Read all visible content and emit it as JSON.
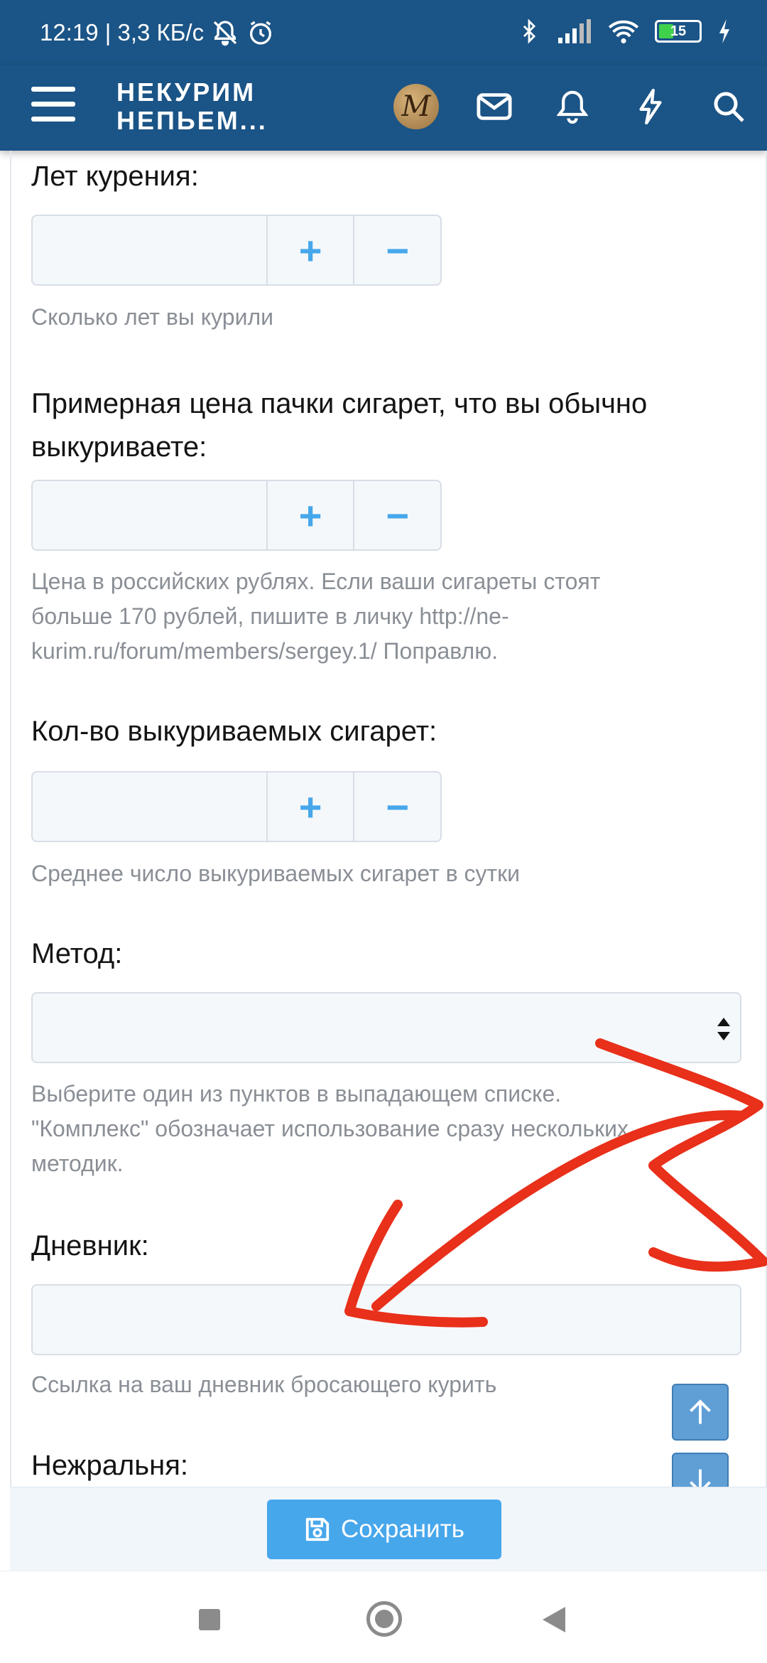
{
  "status_bar": {
    "time_speed": "12:19 | 3,3 КБ/с",
    "battery": "15"
  },
  "header": {
    "brand_line1": "НЕКУРИМ",
    "brand_line2": "НЕПЬЕМ..."
  },
  "form": {
    "years": {
      "label": "Лет курения:",
      "hint": "Сколько лет вы курили"
    },
    "price": {
      "label_line1": "Примерная цена пачки сигарет, что вы обычно",
      "label_line2": "выкуриваете:",
      "hint_line1": "Цена в российских рублях. Если ваши сигареты стоят",
      "hint_line2": "больше 170 рублей, пишите в личку http://ne-",
      "hint_line3": "kurim.ru/forum/members/sergey.1/ Поправлю."
    },
    "count": {
      "label": "Кол-во выкуриваемых сигарет:",
      "hint": "Среднее число выкуриваемых сигарет в сутки"
    },
    "method": {
      "label": "Метод:",
      "hint_line1": "Выберите один из пунктов в выпадающем списке.",
      "hint_line2": "\"Комплекс\" обозначает использование сразу нескольких",
      "hint_line3": "методик."
    },
    "diary": {
      "label": "Дневник:",
      "hint": "Ссылка на ваш дневник бросающего курить"
    },
    "next": {
      "label": "Нежральня:"
    },
    "plus": "+",
    "minus": "−"
  },
  "actions": {
    "save_label": "Сохранить"
  },
  "colors": {
    "header_bg": "#1b5486",
    "accent": "#47a7eb",
    "annotation": "#e8301a"
  },
  "icons": [
    "menu-icon",
    "avatar",
    "mail-icon",
    "bell-icon",
    "lightning-icon",
    "search-icon",
    "save-icon",
    "arrow-up-icon",
    "arrow-down-icon"
  ]
}
